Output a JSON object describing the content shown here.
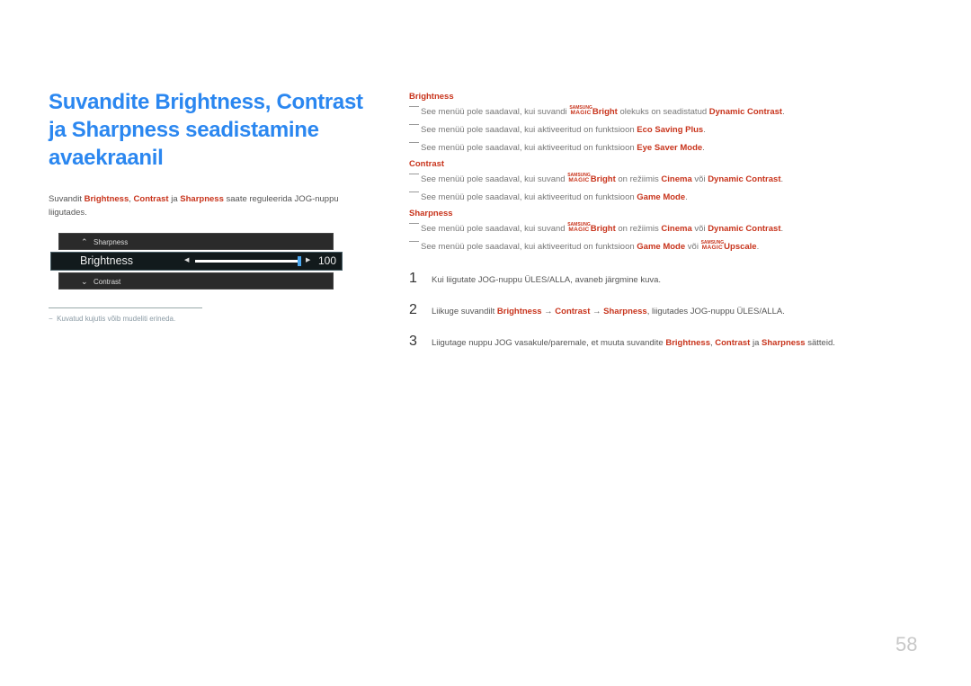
{
  "title": "Suvandite Brightness, Contrast ja Sharpness seadistamine avaekraanil",
  "intro": {
    "prefix": "Suvandit ",
    "brightness": "Brightness",
    "comma": ", ",
    "contrast": "Contrast",
    "ja": " ja ",
    "sharpness": "Sharpness",
    "suffix": " saate reguleerida JOG-nuppu liigutades."
  },
  "osd": {
    "prev_item": "Sharpness",
    "current_item": "Brightness",
    "next_item": "Contrast",
    "value": "100",
    "slider_fraction": 1.0,
    "icons": {
      "up": "chevron-up-icon",
      "down": "chevron-down-icon",
      "left": "triangle-left-icon",
      "right": "triangle-right-icon"
    }
  },
  "footnote": "Kuvatud kujutis võib mudeliti erineda.",
  "magic_logo": {
    "top": "SAMSUNG",
    "bottom": "MAGIC"
  },
  "sections": {
    "brightness": {
      "heading": "Brightness",
      "notes": [
        {
          "a": "See menüü pole saadaval, kui suvandi ",
          "magic": "Bright",
          "b": " olekuks on seadistatud ",
          "h1": "Dynamic Contrast",
          "c": "."
        },
        {
          "a": "See menüü pole saadaval, kui aktiveeritud on funktsioon ",
          "h1": "Eco Saving Plus",
          "c": "."
        },
        {
          "a": "See menüü pole saadaval, kui aktiveeritud on funktsioon ",
          "h1": "Eye Saver Mode",
          "c": "."
        }
      ]
    },
    "contrast": {
      "heading": "Contrast",
      "notes": [
        {
          "a": "See menüü pole saadaval, kui suvand ",
          "magic": "Bright",
          "b": " on režiimis ",
          "h1": "Cinema",
          "d": " või ",
          "h2": "Dynamic Contrast",
          "c": "."
        },
        {
          "a": "See menüü pole saadaval, kui aktiveeritud on funktsioon ",
          "h1": "Game Mode",
          "c": "."
        }
      ]
    },
    "sharpness": {
      "heading": "Sharpness",
      "notes": [
        {
          "a": "See menüü pole saadaval, kui suvand ",
          "magic": "Bright",
          "b": " on režiimis ",
          "h1": "Cinema",
          "d": " või ",
          "h2": "Dynamic Contrast",
          "c": "."
        },
        {
          "a": "See menüü pole saadaval, kui aktiveeritud on funktsioon ",
          "h1": "Game Mode",
          "d": " või ",
          "magic2": "Upscale",
          "c": "."
        }
      ]
    }
  },
  "steps": [
    {
      "num": "1",
      "text": "Kui liigutate JOG-nuppu ÜLES/ALLA, avaneb järgmine kuva."
    },
    {
      "num": "2",
      "pre": "Liikuge suvandilt ",
      "h1": "Brightness",
      "arrow": " → ",
      "h2": "Contrast",
      "h3": "Sharpness",
      "post": ", liigutades JOG-nuppu ÜLES/ALLA."
    },
    {
      "num": "3",
      "pre": "Liigutage nuppu JOG vasakule/paremale, et muuta suvandite ",
      "h1": "Brightness",
      "comma": ", ",
      "h2": "Contrast",
      "ja": " ja ",
      "h3": "Sharpness",
      "post": " sätteid."
    }
  ],
  "page_number": "58",
  "colors": {
    "title": "#2b87f0",
    "highlight": "#c8341c",
    "slider_knob": "#4aa8f0"
  }
}
